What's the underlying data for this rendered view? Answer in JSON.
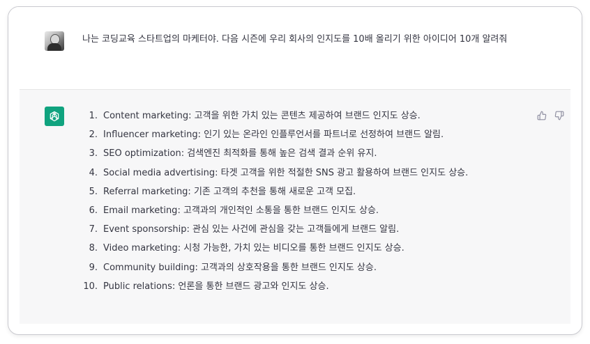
{
  "user_message": {
    "text": "나는 코딩교육 스타트업의 마케터야. 다음 시즌에 우리 회사의 인지도를 10배 올리기 위한 아이디어 10개 알려줘"
  },
  "assistant_message": {
    "items": [
      {
        "num": "1.",
        "text": "Content marketing: 고객을 위한 가치 있는 콘텐츠 제공하여 브랜드 인지도 상승."
      },
      {
        "num": "2.",
        "text": "Influencer marketing: 인기 있는 온라인 인플루언서를 파트너로 선정하여 브랜드 알림."
      },
      {
        "num": "3.",
        "text": "SEO optimization: 검색엔진 최적화를 통해 높은 검색 결과 순위 유지."
      },
      {
        "num": "4.",
        "text": "Social media advertising: 타겟 고객을 위한 적절한 SNS 광고 활용하여 브랜드 인지도 상승."
      },
      {
        "num": "5.",
        "text": "Referral marketing: 기존 고객의 추천을 통해 새로운 고객 모집."
      },
      {
        "num": "6.",
        "text": "Email marketing: 고객과의 개인적인 소통을 통한 브랜드 인지도 상승."
      },
      {
        "num": "7.",
        "text": "Event sponsorship: 관심 있는 사건에 관심을 갖는 고객들에게 브랜드 알림."
      },
      {
        "num": "8.",
        "text": "Video marketing: 시청 가능한, 가치 있는 비디오를 통한 브랜드 인지도 상승."
      },
      {
        "num": "9.",
        "text": "Community building: 고객과의 상호작용을 통한 브랜드 인지도 상승."
      },
      {
        "num": "10.",
        "text": "Public relations: 언론을 통한 브랜드 광고와 인지도 상승."
      }
    ]
  },
  "icons": {
    "user_avatar": "user-avatar",
    "assistant_logo": "openai-logo-icon",
    "thumbs_up": "thumbs-up-icon",
    "thumbs_down": "thumbs-down-icon"
  },
  "colors": {
    "assistant_logo_bg": "#10a37f",
    "assistant_bg": "#f7f7f8",
    "text": "#343541"
  }
}
